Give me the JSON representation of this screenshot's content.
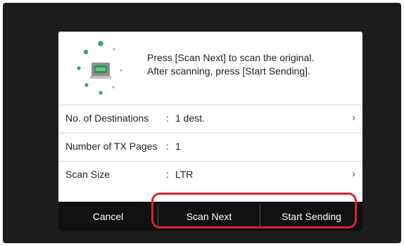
{
  "dialog": {
    "message_line1": "Press [Scan Next] to scan the original.",
    "message_line2": "After scanning, press [Start Sending].",
    "icon": "scanning-progress-icon"
  },
  "rows": [
    {
      "label": "No. of Destinations",
      "colon": ":",
      "value": "1 dest.",
      "has_chevron": true,
      "chevron": "›"
    },
    {
      "label": "Number of TX Pages",
      "colon": ":",
      "value": "1",
      "has_chevron": false
    },
    {
      "label": "Scan Size",
      "colon": ":",
      "value": "LTR",
      "has_chevron": true,
      "chevron": "›"
    }
  ],
  "buttons": {
    "cancel": "Cancel",
    "scan_next": "Scan Next",
    "start_sending": "Start Sending"
  },
  "colors": {
    "screen_bg": "#1d1d1d",
    "button_bar": "#111111",
    "highlight": "#e01e2d",
    "icon_green": "#3aa564"
  }
}
